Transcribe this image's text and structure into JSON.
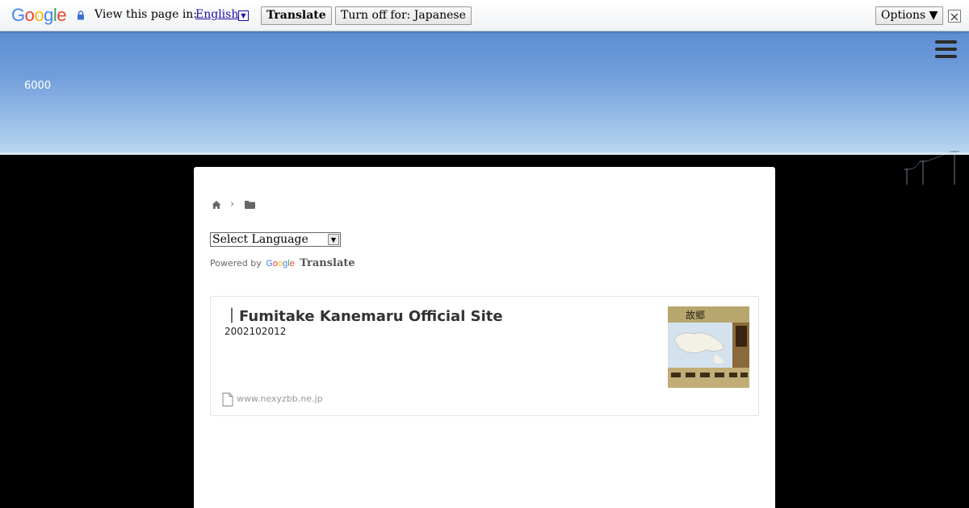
{
  "translate_bar": {
    "logo_letters": [
      "G",
      "o",
      "o",
      "g",
      "l",
      "e"
    ],
    "logo_colors": [
      "#4285f4",
      "#ea4335",
      "#fbbc05",
      "#4285f4",
      "#34a853",
      "#ea4335"
    ],
    "prompt": "View this page in:",
    "language": "English",
    "translate_label": "Translate",
    "turn_off_label": "Turn off for: Japanese",
    "options_label": "Options ▼",
    "lock_icon": "lock-icon",
    "close_icon": "close-icon"
  },
  "hero": {
    "count": "6000",
    "menu_icon": "hamburger-menu-icon"
  },
  "breadcrumb": {
    "home_icon": "home-icon",
    "separator": "›",
    "folder_icon": "folder-icon"
  },
  "language_widget": {
    "select_value": "Select Language",
    "powered_by": "Powered by",
    "google": "Google",
    "translate": "Translate"
  },
  "link_card": {
    "title": "｜Fumitake Kanemaru Official Site",
    "description": "2002102012",
    "domain": "www.nexyzbb.ne.jp"
  },
  "colors": {
    "sky_top": "#5c8ed3",
    "sky_bottom": "#b9d6f0",
    "link_blue": "#1a0dab"
  }
}
